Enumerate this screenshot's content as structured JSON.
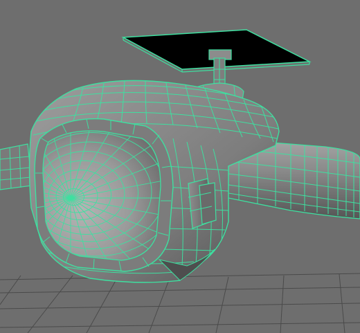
{
  "viewport": {
    "background_color": "#6e6e6e",
    "grid_color": "#4a4a4a",
    "wire_color": "#3ee0a0",
    "mesh_shade_light": "#9a9a9a",
    "mesh_shade_mid": "#808080",
    "mesh_shade_dark": "#4e4e4e",
    "panel_color": "#000000"
  },
  "mesh": {
    "object": "polygon-mesh-model",
    "selected": true,
    "display_mode": "wireframe-on-shaded"
  }
}
